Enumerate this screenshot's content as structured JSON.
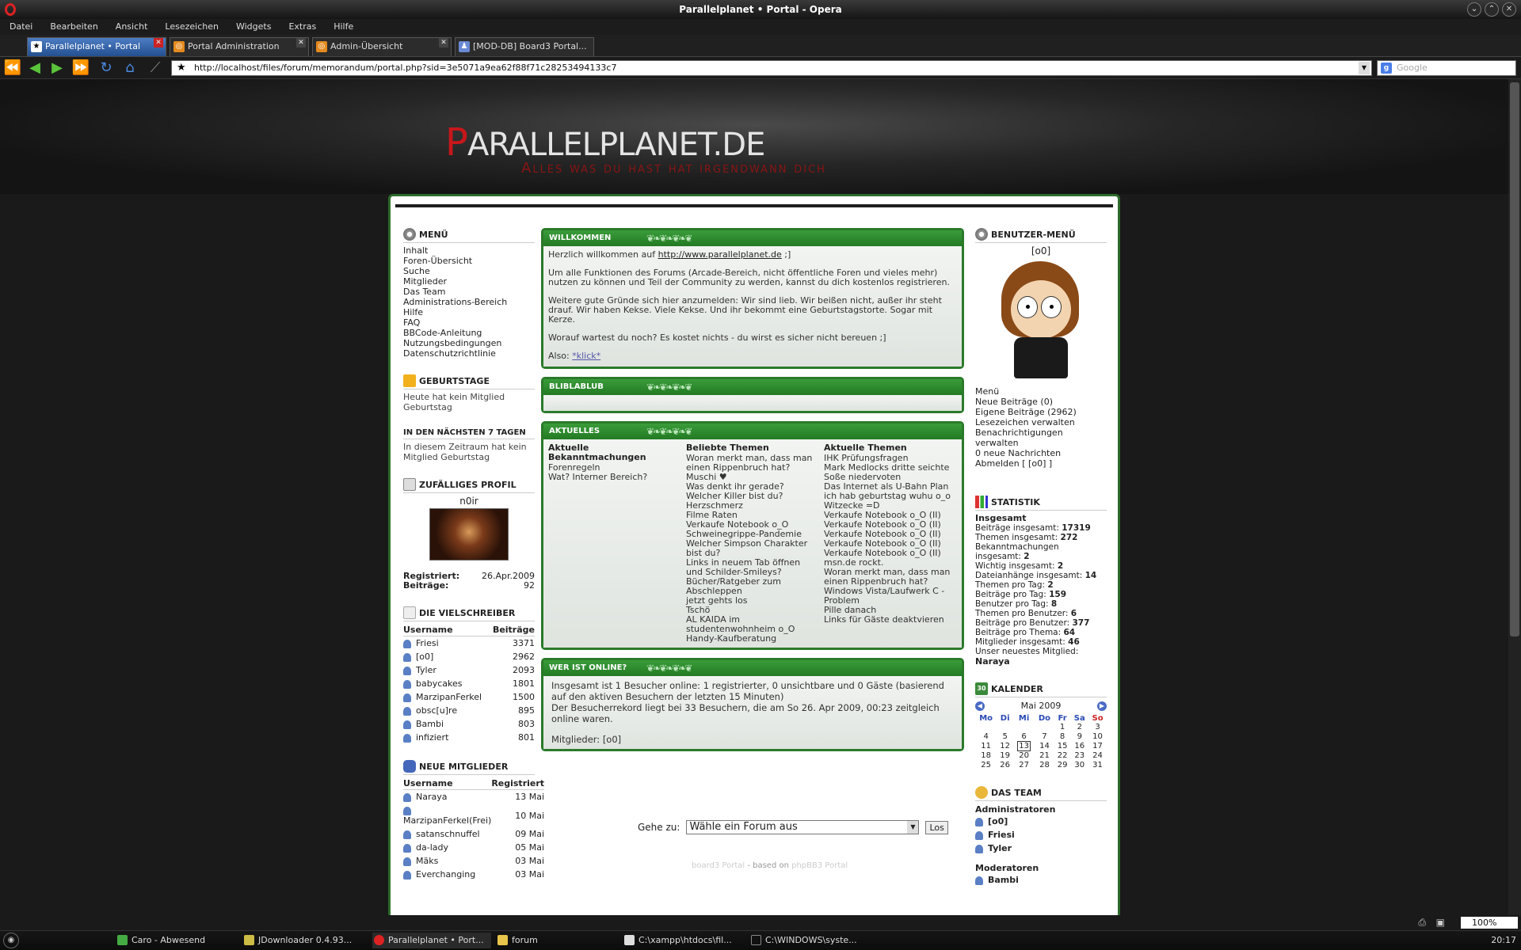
{
  "window": {
    "title": "Parallelplanet • Portal - Opera"
  },
  "menu": [
    "Datei",
    "Bearbeiten",
    "Ansicht",
    "Lesezeichen",
    "Widgets",
    "Extras",
    "Hilfe"
  ],
  "tabs": [
    {
      "label": "Parallelplanet • Portal",
      "active": true
    },
    {
      "label": "Portal Administration",
      "active": false
    },
    {
      "label": "Admin-Übersicht",
      "active": false
    },
    {
      "label": "[MOD-DB] Board3 Portal...",
      "active": false
    }
  ],
  "address": {
    "url": "http://localhost/files/forum/memorandum/portal.php?sid=3e5071a9ea62f88f71c28253494133c7",
    "search_placeholder": "Google"
  },
  "site": {
    "logo_first": "P",
    "logo_rest": "ARALLELPLANET.DE",
    "slogan": "Alles was du hast hat irgendwann dich"
  },
  "left": {
    "menu_title": "Menü",
    "menu_items": [
      "Inhalt",
      "Foren-Übersicht",
      "Suche",
      "Mitglieder",
      "Das Team",
      "Administrations-Bereich",
      "Hilfe",
      "FAQ",
      "BBCode-Anleitung",
      "Nutzungsbedingungen",
      "Datenschutzrichtlinie"
    ],
    "birthdays_title": "Geburtstage",
    "birthdays_text": "Heute hat kein Mitglied Geburtstag",
    "next7_title": "In den nächsten 7 Tagen",
    "next7_text": "In diesem Zeitraum hat kein Mitglied Geburtstag",
    "random_title": "Zufälliges Profil",
    "random_name": "n0ir",
    "random_reg_label": "Registriert:",
    "random_reg": "26.Apr.2009",
    "random_posts_label": "Beiträge:",
    "random_posts": "92",
    "top_title": "Die Vielschreiber",
    "top_col_user": "Username",
    "top_col_posts": "Beiträge",
    "top": [
      [
        "Friesi",
        "3371"
      ],
      [
        "[o0]",
        "2962"
      ],
      [
        "Tyler",
        "2093"
      ],
      [
        "babycakes",
        "1801"
      ],
      [
        "MarzipanFerkel",
        "1500"
      ],
      [
        "obsc[u]re",
        "895"
      ],
      [
        "Bambi",
        "803"
      ],
      [
        "infiziert",
        "801"
      ]
    ],
    "new_title": "Neue Mitglieder",
    "new_col_user": "Username",
    "new_col_reg": "Registriert",
    "new": [
      [
        "Naraya",
        "13 Mai"
      ],
      [
        "MarzipanFerkel(Frei)",
        "10 Mai"
      ],
      [
        "satanschnuffel",
        "09 Mai"
      ],
      [
        "da-lady",
        "05 Mai"
      ],
      [
        "Mäks",
        "03 Mai"
      ],
      [
        "Everchanging",
        "03 Mai"
      ]
    ]
  },
  "center": {
    "welcome_title": "Willkommen",
    "welcome_p1_pre": "Herzlich willkommen auf",
    "welcome_p1_link": "http://www.parallelplanet.de",
    "welcome_p1_post": ";]",
    "welcome_p2": "Um alle Funktionen des Forums (Arcade-Bereich, nicht öffentliche Foren und vieles mehr) nutzen zu können und Teil der Community zu werden, kannst du dich kostenlos registrieren.",
    "welcome_p3": "Weitere gute Gründe sich hier anzumelden: Wir sind lieb. Wir beißen nicht, außer ihr steht drauf. Wir haben Kekse. Viele Kekse. Und ihr bekommt eine Geburtstagstorte. Sogar mit Kerze.",
    "welcome_p4": "Worauf wartest du noch? Es kostet nichts - du wirst es sicher nicht bereuen ;]",
    "welcome_p5_pre": "Also:",
    "welcome_p5_link": "*klick*",
    "blib_title": "Bliblablub",
    "news_title": "Aktuelles",
    "news_col1_title": "Aktuelle Bekanntmachungen",
    "news_col1": [
      "Forenregeln",
      "Wat? Interner Bereich?"
    ],
    "news_col2_title": "Beliebte Themen",
    "news_col2": [
      "Woran merkt man, dass man einen Rippenbruch hat?",
      "Muschi ♥",
      "Was denkt ihr gerade?",
      "Welcher Killer bist du?",
      "Herzschmerz",
      "Filme Raten",
      "Verkaufe Notebook o_O",
      "Schweinegrippe-Pandemie",
      "Welcher Simpson Charakter bist du?",
      "Links in neuem Tab öffnen und Schilder-Smileys?",
      "Bücher/Ratgeber zum Abschleppen",
      "jetzt gehts los",
      "Tschö",
      "AL KAIDA im studentenwohnheim o_O",
      "Handy-Kaufberatung"
    ],
    "news_col3_title": "Aktuelle Themen",
    "news_col3": [
      "IHK Prüfungsfragen",
      "Mark Medlocks dritte seichte Soße niedervoten",
      "Das Internet als U-Bahn Plan",
      "ich hab geburtstag wuhu o_o",
      "Witzecke =D",
      "Verkaufe Notebook o_O (II)",
      "Verkaufe Notebook o_O (II)",
      "Verkaufe Notebook o_O (II)",
      "Verkaufe Notebook o_O (II)",
      "Verkaufe Notebook o_O (II)",
      "msn.de rockt.",
      "Woran merkt man, dass man einen Rippenbruch hat?",
      "Windows Vista/Laufwerk C - Problem",
      "Pille danach",
      "Links für Gäste deaktvieren"
    ],
    "online_title": "Wer ist online?",
    "online_l1": "Insgesamt ist 1 Besucher online: 1 registrierter, 0 unsichtbare und 0 Gäste (basierend auf den aktiven Besuchern der letzten 15 Minuten)",
    "online_l2": "Der Besucherrekord liegt bei 33 Besuchern, die am So 26. Apr 2009, 00:23 zeitgleich online waren.",
    "online_l3": "Mitglieder: [o0]",
    "goto_label": "Gehe zu:",
    "goto_value": "Wähle ein Forum aus",
    "goto_button": "Los",
    "footer_a": "board3 Portal",
    "footer_b": " - based on ",
    "footer_c": "phpBB3 Portal"
  },
  "right": {
    "user_title": "Benutzer-Menü",
    "user_name": "[o0]",
    "user_menu_title": "Menü",
    "user_menu": [
      "Neue Beiträge (0)",
      "Eigene Beiträge (2962)",
      "Lesezeichen verwalten",
      "Benachrichtigungen verwalten",
      "0 neue Nachrichten",
      "Abmelden [ [o0] ]"
    ],
    "stat_title": "Statistik",
    "stat_total": "Insgesamt",
    "stats": [
      [
        "Beiträge insgesamt:",
        "17319"
      ],
      [
        "Themen insgesamt:",
        "272"
      ],
      [
        "Bekanntmachungen insgesamt:",
        "2"
      ],
      [
        "Wichtig insgesamt:",
        "2"
      ],
      [
        "Dateianhänge insgesamt:",
        "14"
      ],
      [
        "Themen pro Tag:",
        "2"
      ],
      [
        "Beiträge pro Tag:",
        "159"
      ],
      [
        "Benutzer pro Tag:",
        "8"
      ],
      [
        "Themen pro Benutzer:",
        "6"
      ],
      [
        "Beiträge pro Benutzer:",
        "377"
      ],
      [
        "Beiträge pro Thema:",
        "64"
      ],
      [
        "Mitglieder insgesamt:",
        "46"
      ]
    ],
    "newest_label": "Unser neuestes Mitglied:",
    "newest": "Naraya",
    "cal_title": "Kalender",
    "cal_month": "Mai 2009",
    "cal_days": [
      "Mo",
      "Di",
      "Mi",
      "Do",
      "Fr",
      "Sa",
      "So"
    ],
    "cal_weeks": [
      [
        "",
        "",
        "",
        "",
        "1",
        "2",
        "3"
      ],
      [
        "4",
        "5",
        "6",
        "7",
        "8",
        "9",
        "10"
      ],
      [
        "11",
        "12",
        "13",
        "14",
        "15",
        "16",
        "17"
      ],
      [
        "18",
        "19",
        "20",
        "21",
        "22",
        "23",
        "24"
      ],
      [
        "25",
        "26",
        "27",
        "28",
        "29",
        "30",
        "31"
      ]
    ],
    "cal_today": "13",
    "team_title": "Das Team",
    "team_admin_label": "Administratoren",
    "team_admins": [
      "[o0]",
      "Friesi",
      "Tyler"
    ],
    "team_mod_label": "Moderatoren",
    "team_mods": [
      "Bambi"
    ]
  },
  "status": {
    "zoom": "100%"
  },
  "taskbar": {
    "items": [
      "Caro - Abwesend",
      "JDownloader 0.4.93...",
      "Parallelplanet • Port...",
      "forum",
      "C:\\xampp\\htdocs\\fil...",
      "C:\\WINDOWS\\syste..."
    ],
    "clock": "20:17"
  }
}
